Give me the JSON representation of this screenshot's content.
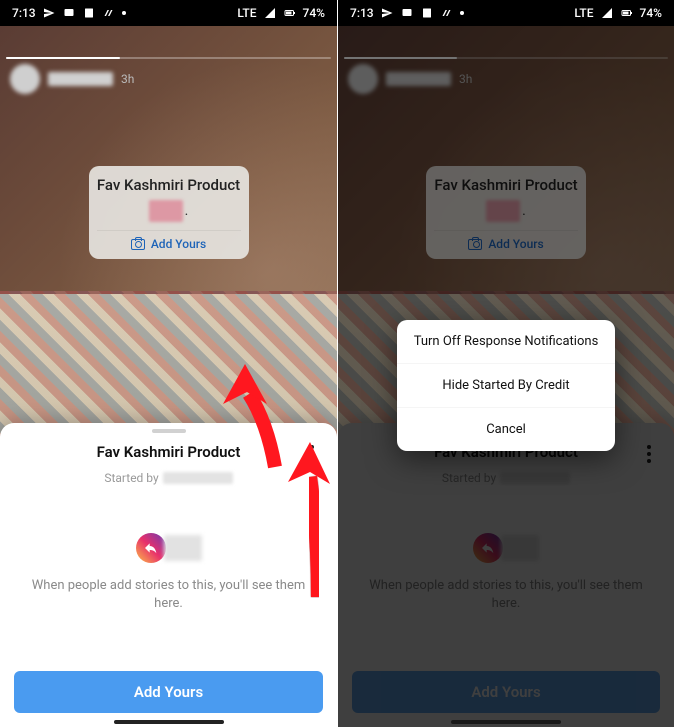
{
  "status": {
    "time": "7:13",
    "network": "LTE",
    "battery": "74%"
  },
  "story": {
    "time_ago": "3h",
    "sticker_title": "Fav Kashmiri Product",
    "sticker_add": "Add Yours"
  },
  "sheet": {
    "title": "Fav Kashmiri Product",
    "started_prefix": "Started by",
    "empty_text": "When people add stories to this, you'll see them here.",
    "add_button": "Add Yours"
  },
  "popup": {
    "opt1": "Turn Off Response Notifications",
    "opt2": "Hide Started By Credit",
    "opt3": "Cancel"
  }
}
